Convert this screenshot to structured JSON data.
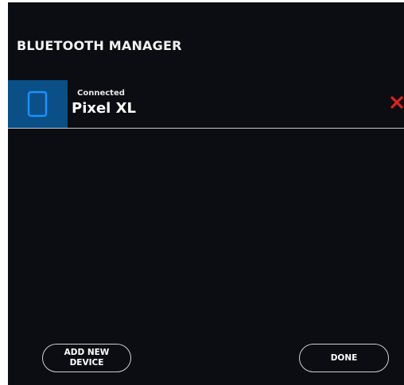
{
  "dialog": {
    "title": "BLUETOOTH MANAGER"
  },
  "devices": [
    {
      "status": "Connected",
      "name": "Pixel XL",
      "icon": "tablet-icon",
      "remove_icon": "close-icon"
    }
  ],
  "buttons": {
    "add_new_device": "ADD NEW\nDEVICE",
    "done": "DONE"
  },
  "colors": {
    "background": "#0c0d12",
    "device_icon_bg": "#0a4f86",
    "device_icon_stroke": "#1e90ff",
    "remove_x": "#e0231b"
  }
}
